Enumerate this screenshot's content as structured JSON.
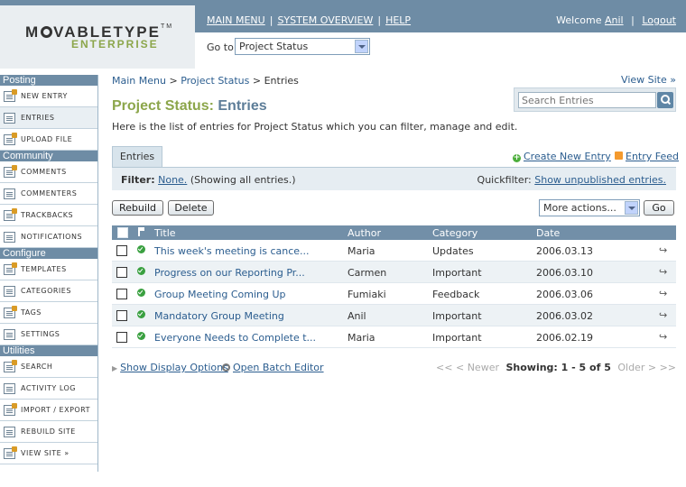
{
  "header": {
    "logo_prefix": "M",
    "logo_suffix": "VABLETYPE",
    "logo_tm": "TM",
    "logo_sub": "ENTERPRISE",
    "nav": [
      "MAIN MENU",
      "SYSTEM OVERVIEW",
      "HELP"
    ],
    "welcome_text": "Welcome",
    "user": "Anil",
    "logout": "Logout",
    "goto_label": "Go to:",
    "goto_value": "Project Status"
  },
  "sidebar": {
    "sections": [
      {
        "title": "Posting",
        "items": [
          {
            "label": "NEW ENTRY",
            "icon": "new-entry-icon"
          },
          {
            "label": "ENTRIES",
            "icon": "entries-icon",
            "active": true
          },
          {
            "label": "UPLOAD FILE",
            "icon": "upload-file-icon"
          }
        ]
      },
      {
        "title": "Community",
        "items": [
          {
            "label": "COMMENTS",
            "icon": "comments-icon"
          },
          {
            "label": "COMMENTERS",
            "icon": "commenters-icon"
          },
          {
            "label": "TRACKBACKS",
            "icon": "trackbacks-icon"
          },
          {
            "label": "NOTIFICATIONS",
            "icon": "notifications-icon"
          }
        ]
      },
      {
        "title": "Configure",
        "items": [
          {
            "label": "TEMPLATES",
            "icon": "templates-icon"
          },
          {
            "label": "CATEGORIES",
            "icon": "categories-icon"
          },
          {
            "label": "TAGS",
            "icon": "tags-icon"
          },
          {
            "label": "SETTINGS",
            "icon": "settings-icon"
          }
        ]
      },
      {
        "title": "Utilities",
        "items": [
          {
            "label": "SEARCH",
            "icon": "search-icon"
          },
          {
            "label": "ACTIVITY LOG",
            "icon": "activity-log-icon"
          },
          {
            "label": "IMPORT / EXPORT",
            "icon": "import-export-icon"
          },
          {
            "label": "REBUILD SITE",
            "icon": "rebuild-site-icon"
          },
          {
            "label": "VIEW SITE »",
            "icon": "view-site-icon"
          }
        ]
      }
    ]
  },
  "breadcrumb": {
    "main_menu": "Main Menu",
    "sep1": ">",
    "project": "Project Status",
    "sep2": ">",
    "current": "Entries"
  },
  "view_site": "View Site »",
  "search": {
    "placeholder": "Search Entries"
  },
  "page": {
    "title_part1": "Project Status:",
    "title_part2": "Entries",
    "description": "Here is the list of entries for Project Status which you can filter, manage and edit."
  },
  "tabs": {
    "entries": "Entries"
  },
  "actions": {
    "create": "Create New Entry",
    "feed": "Entry Feed",
    "rebuild": "Rebuild",
    "delete": "Delete",
    "more_actions": "More actions...",
    "go": "Go"
  },
  "filter": {
    "label": "Filter:",
    "none_link": "None.",
    "note": "(Showing all entries.)",
    "quickfilter_label": "Quickfilter:",
    "quickfilter_link": "Show unpublished entries."
  },
  "table": {
    "columns": [
      "Title",
      "Author",
      "Category",
      "Date"
    ],
    "rows": [
      {
        "title": "This week's meeting is cance...",
        "author": "Maria",
        "category": "Updates",
        "date": "2006.03.13"
      },
      {
        "title": "Progress on our Reporting Pr...",
        "author": "Carmen",
        "category": "Important",
        "date": "2006.03.10"
      },
      {
        "title": "Group Meeting Coming Up",
        "author": "Fumiaki",
        "category": "Feedback",
        "date": "2006.03.06"
      },
      {
        "title": "Mandatory Group Meeting",
        "author": "Anil",
        "category": "Important",
        "date": "2006.03.02"
      },
      {
        "title": "Everyone Needs to Complete t...",
        "author": "Maria",
        "category": "Important",
        "date": "2006.02.19"
      }
    ]
  },
  "footer": {
    "display_options": "Show Display Options",
    "batch_editor": "Open Batch Editor",
    "first": "<<",
    "newer": "< Newer",
    "showing": "Showing: 1 - 5 of 5",
    "older": "Older >",
    "last": ">>"
  }
}
